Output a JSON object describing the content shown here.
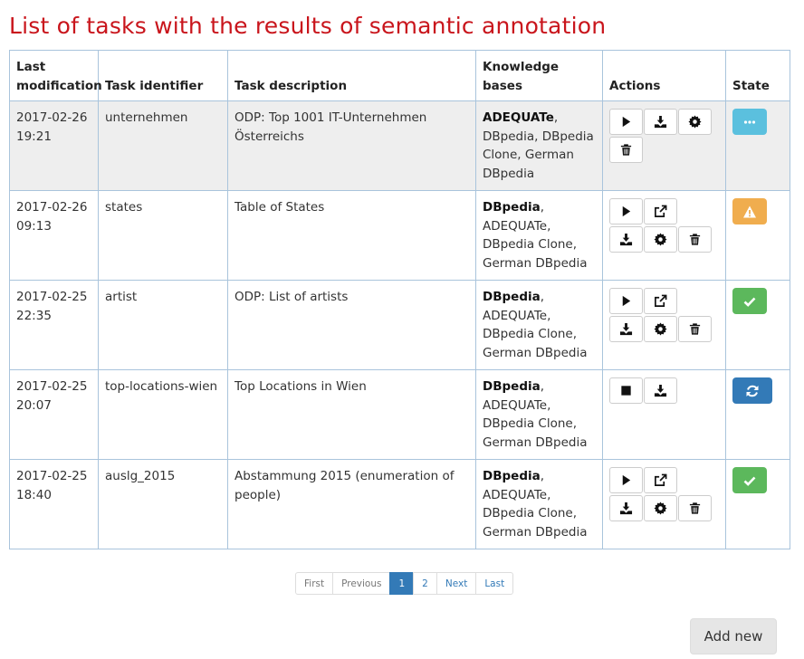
{
  "page": {
    "title": "List of tasks with the results of semantic annotation"
  },
  "table": {
    "headers": {
      "modified": "Last modification",
      "identifier": "Task identifier",
      "description": "Task description",
      "kb": "Knowledge bases",
      "actions": "Actions",
      "state": "State"
    },
    "rows": [
      {
        "date": "2017-02-26",
        "time": "19:21",
        "identifier": "unternehmen",
        "description": "ODP: Top 1001 IT-Unternehmen Österreichs",
        "kb_primary": "ADEQUATe",
        "kb_rest": ", DBpedia, DBpedia Clone, German DBpedia",
        "state": "running"
      },
      {
        "date": "2017-02-26",
        "time": "09:13",
        "identifier": "states",
        "description": "Table of States",
        "kb_primary": "DBpedia",
        "kb_rest": ", ADEQUATe, DBpedia Clone, German DBpedia",
        "state": "warning"
      },
      {
        "date": "2017-02-25",
        "time": "22:35",
        "identifier": "artist",
        "description": "ODP: List of artists",
        "kb_primary": "DBpedia",
        "kb_rest": ", ADEQUATe, DBpedia Clone, German DBpedia",
        "state": "success"
      },
      {
        "date": "2017-02-25",
        "time": "20:07",
        "identifier": "top-locations-wien",
        "description": "Top Locations in Wien",
        "kb_primary": "DBpedia",
        "kb_rest": ", ADEQUATe, DBpedia Clone, German DBpedia",
        "state": "processing"
      },
      {
        "date": "2017-02-25",
        "time": "18:40",
        "identifier": "auslg_2015",
        "description": "Abstammung 2015 (enumeration of people)",
        "kb_primary": "DBpedia",
        "kb_rest": ", ADEQUATe, DBpedia Clone, German DBpedia",
        "state": "success"
      }
    ]
  },
  "pagination": {
    "first": "First",
    "previous": "Previous",
    "page1": "1",
    "page2": "2",
    "next": "Next",
    "last": "Last"
  },
  "buttons": {
    "add_new": "Add new"
  },
  "colors": {
    "title": "#c9151c",
    "row_highlight": "#eeeeee",
    "state_running": "#5bc0de",
    "state_warning": "#f0ad4e",
    "state_success": "#5cb85c",
    "state_processing": "#337ab7"
  },
  "icons": {
    "play": "play-icon",
    "stop": "stop-icon",
    "download": "download-icon",
    "external": "external-link-icon",
    "settings": "gear-icon",
    "delete": "trash-icon",
    "running": "ellipsis-icon",
    "warning": "warning-icon",
    "success": "check-icon",
    "processing": "refresh-icon"
  }
}
